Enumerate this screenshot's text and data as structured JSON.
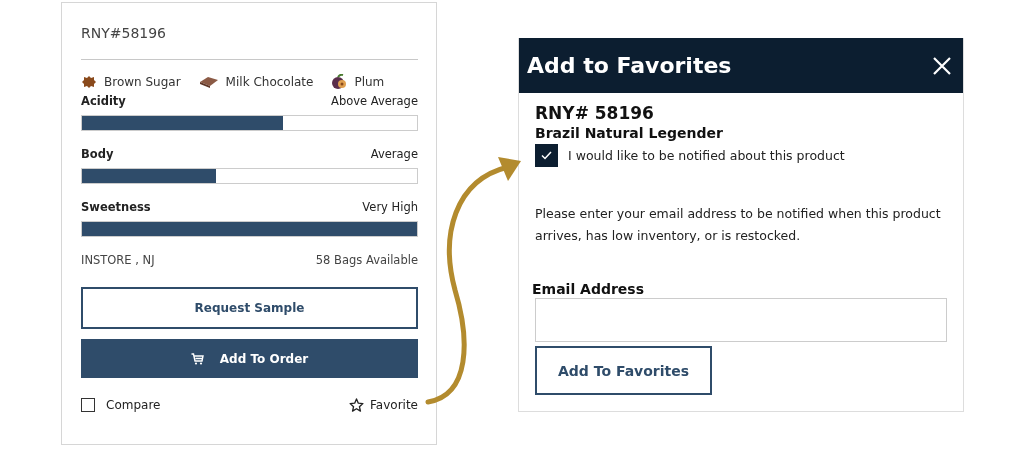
{
  "product_card": {
    "code": "RNY#58196",
    "flavors": [
      {
        "kind": "sugar",
        "label": "Brown Sugar"
      },
      {
        "kind": "chocolate",
        "label": "Milk Chocolate"
      },
      {
        "kind": "plum",
        "label": "Plum"
      }
    ],
    "attributes": [
      {
        "name": "Acidity",
        "reading": "Above Average",
        "level": 0.6
      },
      {
        "name": "Body",
        "reading": "Average",
        "level": 0.4
      },
      {
        "name": "Sweetness",
        "reading": "Very High",
        "level": 1.0
      }
    ],
    "location": "INSTORE , NJ",
    "availability": "58 Bags Available",
    "request_button": "Request Sample",
    "order_button": "Add To Order",
    "compare": {
      "label": "Compare",
      "checked": false
    },
    "favorite": "Favorite"
  },
  "dialog": {
    "title": "Add to Favorites",
    "code": "RNY# 58196",
    "product_name": "Brazil Natural Legender",
    "notify": {
      "label": "I would like to be notified about this product",
      "checked": true
    },
    "message": "Please enter your email address to be notified when this product arrives, has low inventory, or is restocked.",
    "email_label": "Email Address",
    "submit_button": "Add To Favorites"
  }
}
